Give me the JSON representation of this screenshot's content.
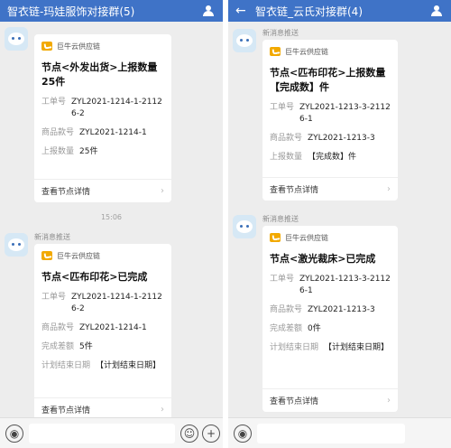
{
  "left": {
    "title": "智衣链-玛娃服饰对接群(5)",
    "time": "15:06",
    "messages": [
      {
        "sender": "",
        "brand": "巨牛云供应链",
        "title": "节点<外发出货>上报数量25件",
        "fields": [
          {
            "k": "工单号",
            "v": "ZYL2021-1214-1-21126-2"
          },
          {
            "k": "商品款号",
            "v": "ZYL2021-1214-1"
          },
          {
            "k": "上报数量",
            "v": "25件"
          }
        ],
        "detail": "查看节点详情"
      },
      {
        "sender": "新消息推送",
        "brand": "巨牛云供应链",
        "title": "节点<匹布印花>已完成",
        "fields": [
          {
            "k": "工单号",
            "v": "ZYL2021-1214-1-21126-2"
          },
          {
            "k": "商品款号",
            "v": "ZYL2021-1214-1"
          },
          {
            "k": "完成差额",
            "v": "5件"
          },
          {
            "k": "计划结束日期",
            "v": "【计划结束日期】"
          }
        ],
        "detail": "查看节点详情"
      }
    ]
  },
  "right": {
    "title": "智衣链_云氏对接群(4)",
    "messages": [
      {
        "sender": "新消息推送",
        "brand": "巨牛云供应链",
        "title": "节点<匹布印花>上报数量【完成数】件",
        "fields": [
          {
            "k": "工单号",
            "v": "ZYL2021-1213-3-21126-1"
          },
          {
            "k": "商品款号",
            "v": "ZYL2021-1213-3"
          },
          {
            "k": "上报数量",
            "v": "【完成数】件"
          }
        ],
        "detail": "查看节点详情"
      },
      {
        "sender": "新消息推送",
        "brand": "巨牛云供应链",
        "title": "节点<激光裁床>已完成",
        "fields": [
          {
            "k": "工单号",
            "v": "ZYL2021-1213-3-21126-1"
          },
          {
            "k": "商品款号",
            "v": "ZYL2021-1213-3"
          },
          {
            "k": "完成差额",
            "v": "0件"
          },
          {
            "k": "计划结束日期",
            "v": "【计划结束日期】"
          }
        ],
        "detail": "查看节点详情"
      }
    ]
  },
  "icons": {
    "back": "back-arrow-icon",
    "group": "group-members-icon",
    "voice": "voice-icon",
    "emoji": "emoji-icon",
    "plus": "plus-icon"
  },
  "colors": {
    "header": "#3f73c7",
    "brand": "#f2a900",
    "background": "#ededed"
  }
}
